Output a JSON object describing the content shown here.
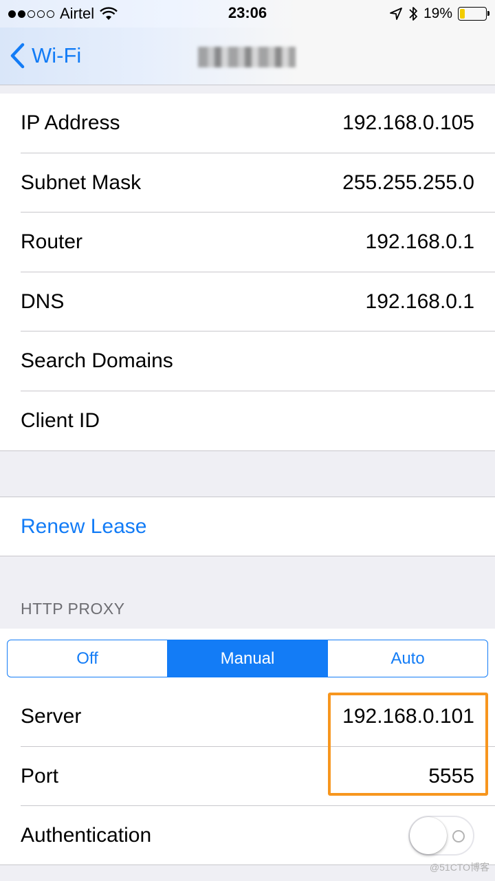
{
  "status_bar": {
    "carrier": "Airtel",
    "time": "23:06",
    "battery_percent": "19%",
    "battery_level": 0.19,
    "icons": [
      "signal-dots-icon",
      "wifi-icon",
      "location-arrow-icon",
      "bluetooth-icon",
      "battery-icon"
    ]
  },
  "nav": {
    "back_label": "Wi-Fi",
    "title": ""
  },
  "ip_rows": [
    {
      "label": "IP Address",
      "value": "192.168.0.105"
    },
    {
      "label": "Subnet Mask",
      "value": "255.255.255.0"
    },
    {
      "label": "Router",
      "value": "192.168.0.1"
    },
    {
      "label": "DNS",
      "value": "192.168.0.1"
    },
    {
      "label": "Search Domains",
      "value": ""
    },
    {
      "label": "Client ID",
      "value": ""
    }
  ],
  "renew_lease": "Renew Lease",
  "http_proxy": {
    "header": "HTTP PROXY",
    "segments": [
      "Off",
      "Manual",
      "Auto"
    ],
    "selected": "Manual",
    "server_label": "Server",
    "server_value": "192.168.0.101",
    "port_label": "Port",
    "port_value": "5555",
    "auth_label": "Authentication",
    "auth_enabled": false
  },
  "colors": {
    "accent": "#137cf6",
    "highlight": "#f7961e",
    "battery_low": "#f2cc00",
    "background": "#efeff4"
  },
  "watermark": "@51CTO博客"
}
